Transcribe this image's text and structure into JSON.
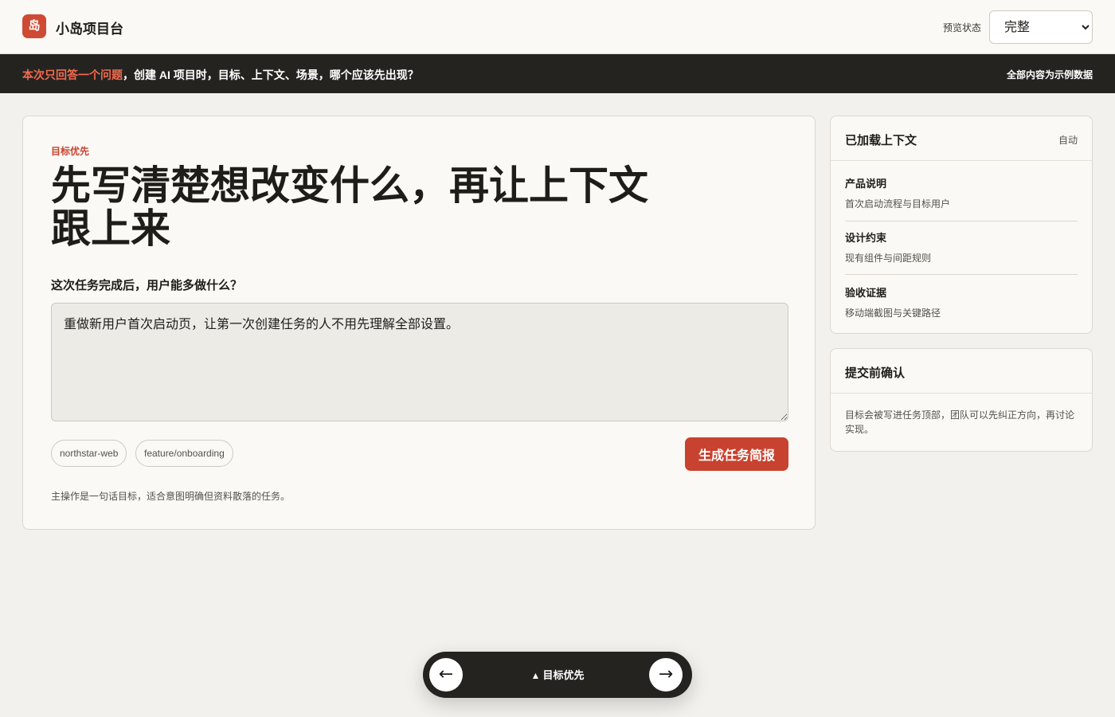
{
  "app": {
    "logo_glyph": "岛",
    "title": "小岛项目台"
  },
  "preview": {
    "label": "预览状态",
    "selected": "完整",
    "options": [
      "完整"
    ]
  },
  "banner": {
    "highlight": "本次只回答一个问题",
    "question": "，创建 AI 项目时，目标、上下文、场景，哪个应该先出现？",
    "note": "全部内容为示例数据"
  },
  "main": {
    "eyebrow": "目标优先",
    "headline": "先写清楚想改变什么，再让上下文跟上来",
    "question": "这次任务完成后，用户能多做什么？",
    "goal_value": "重做新用户首次启动页，让第一次创建任务的人不用先理解全部设置。",
    "chips": [
      "northstar-web",
      "feature/onboarding"
    ],
    "generate_label": "生成任务简报",
    "note": "主操作是一句话目标，适合意图明确但资料散落的任务。"
  },
  "context_panel": {
    "title": "已加载上下文",
    "mode": "自动",
    "items": [
      {
        "title": "产品说明",
        "desc": "首次启动流程与目标用户"
      },
      {
        "title": "设计约束",
        "desc": "现有组件与间距规则"
      },
      {
        "title": "验收证据",
        "desc": "移动端截图与关键路径"
      }
    ]
  },
  "confirm_panel": {
    "title": "提交前确认",
    "text": "目标会被写进任务顶部，团队可以先纠正方向，再讨论实现。"
  },
  "bottom_nav": {
    "prev_glyph": "←",
    "next_glyph": "→",
    "label_glyph": "▲",
    "label": "目标优先"
  },
  "colors": {
    "accent": "#c8432f",
    "banner_bg": "#252320",
    "banner_highlight": "#f26b4f",
    "page_bg": "#f3f1ed"
  }
}
